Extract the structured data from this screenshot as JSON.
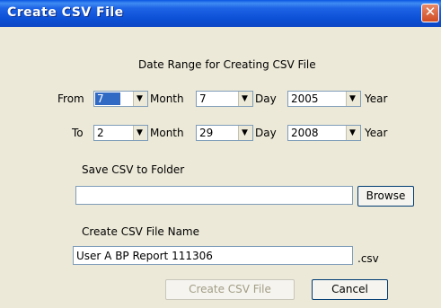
{
  "window": {
    "title": "Create CSV File"
  },
  "header": {
    "date_range_label": "Date Range for Creating CSV File"
  },
  "from_row": {
    "label": "From",
    "month_value": "7",
    "month_label": "Month",
    "day_value": "7",
    "day_label": "Day",
    "year_value": "2005",
    "year_label": "Year"
  },
  "to_row": {
    "label": "To",
    "month_value": "2",
    "month_label": "Month",
    "day_value": "29",
    "day_label": "Day",
    "year_value": "2008",
    "year_label": "Year"
  },
  "folder": {
    "label": "Save CSV to Folder",
    "value": "",
    "browse_label": "Browse"
  },
  "file_name": {
    "label": "Create CSV File Name",
    "value": "User A BP Report 111306",
    "extension": ".csv"
  },
  "buttons": {
    "create_label": "Create CSV File",
    "cancel_label": "Cancel"
  },
  "icons": {
    "close": "close-icon",
    "dropdown": "chevron-down-icon"
  },
  "colors": {
    "title_bar": "#0c50d6",
    "close_button": "#d14b22",
    "selection": "#316ac5",
    "dialog_bg": "#ece9d8"
  }
}
